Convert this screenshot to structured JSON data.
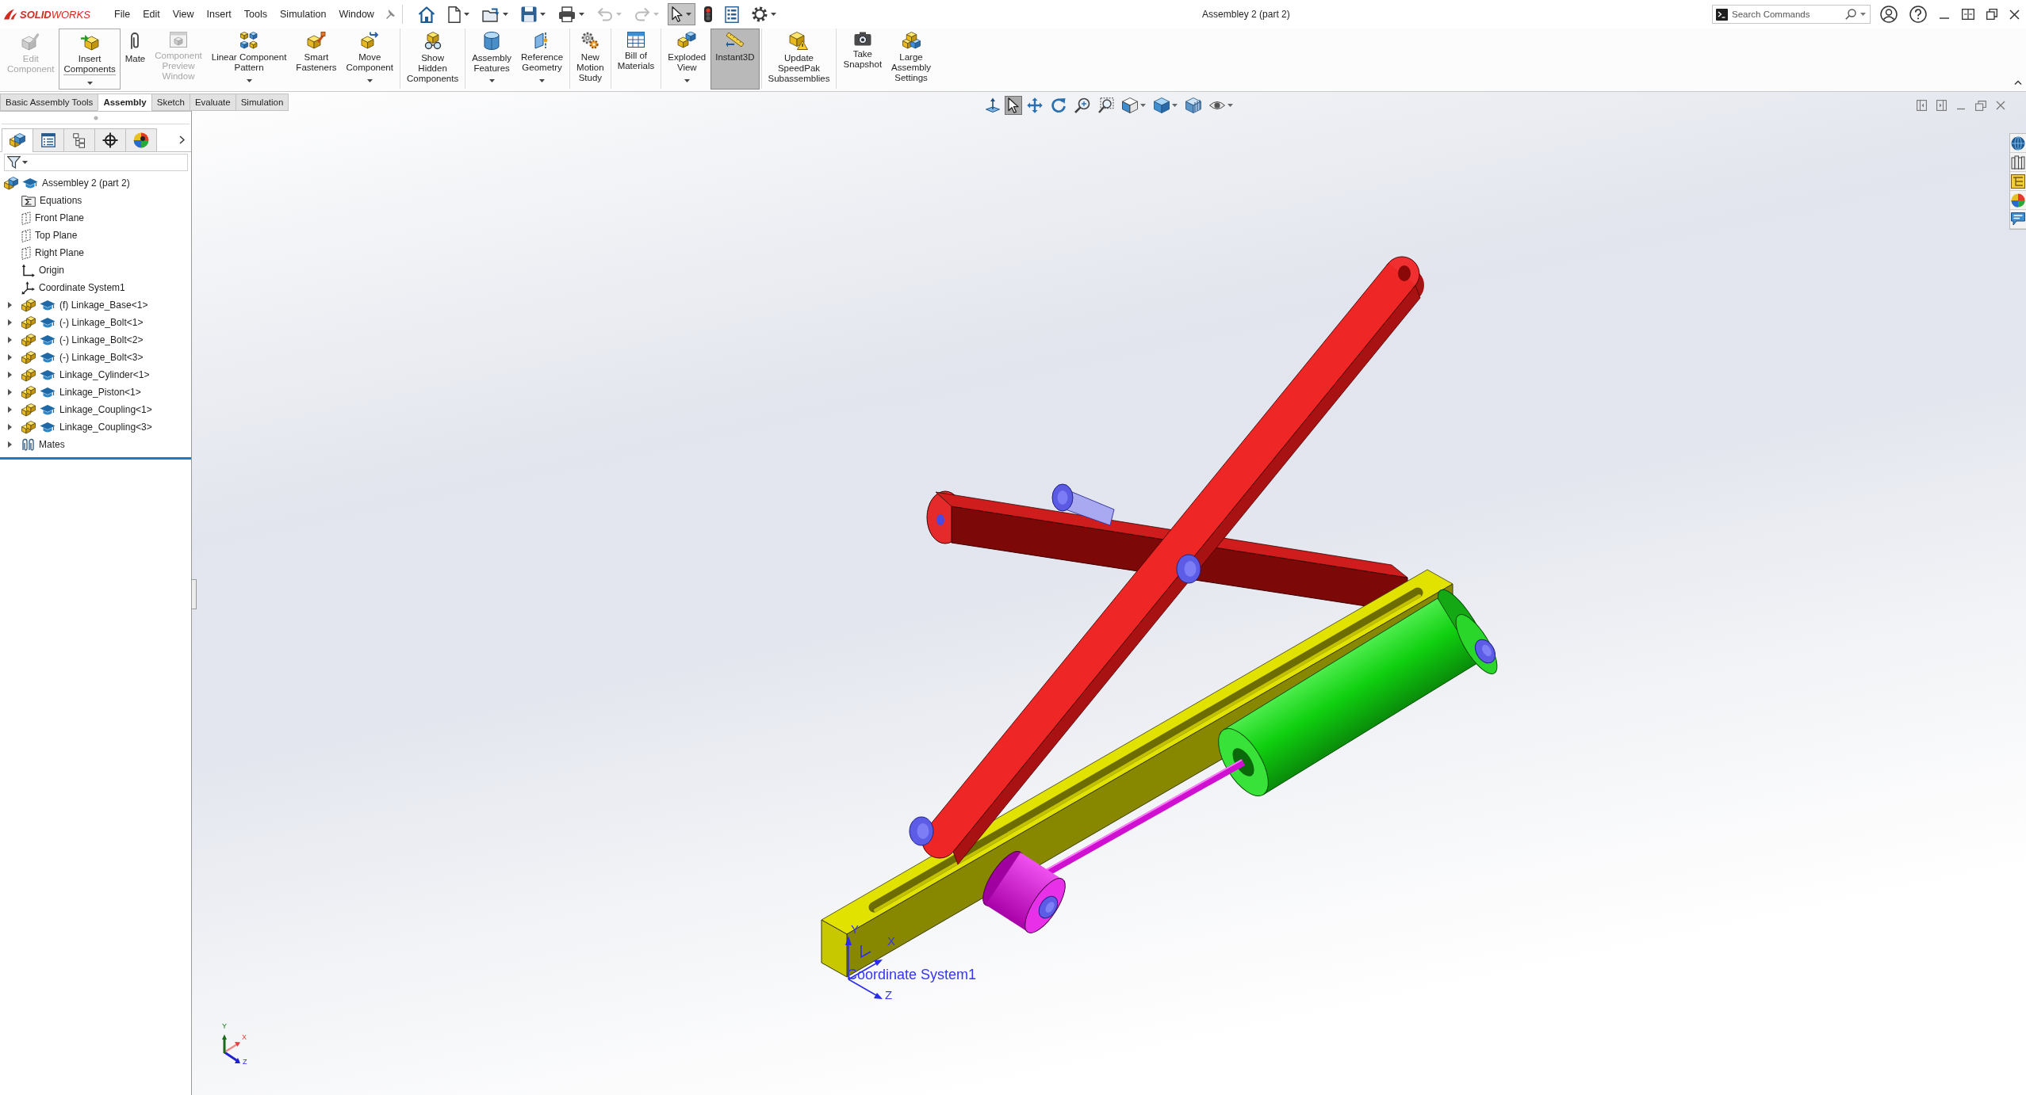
{
  "app": {
    "logo": "**SOLID**WORKS",
    "menu": [
      "File",
      "Edit",
      "View",
      "Insert",
      "Tools",
      "Simulation",
      "Window"
    ]
  },
  "quick_access": [
    {
      "kind": "home",
      "dropdown": false,
      "disabled": false,
      "selected": false
    },
    {
      "kind": "new",
      "dropdown": true,
      "disabled": false,
      "selected": false
    },
    {
      "kind": "open",
      "dropdown": true,
      "disabled": false,
      "selected": false
    },
    {
      "kind": "save",
      "dropdown": true,
      "disabled": false,
      "selected": false
    },
    {
      "kind": "print",
      "dropdown": true,
      "disabled": false,
      "selected": false
    },
    {
      "kind": "undo",
      "dropdown": true,
      "disabled": true,
      "selected": false
    },
    {
      "kind": "redo",
      "dropdown": true,
      "disabled": true,
      "selected": false
    },
    {
      "kind": "select",
      "dropdown": true,
      "disabled": false,
      "selected": true
    },
    {
      "kind": "rebuild",
      "dropdown": false,
      "disabled": false,
      "selected": false
    },
    {
      "kind": "file-properties",
      "dropdown": false,
      "disabled": false,
      "selected": false
    },
    {
      "kind": "options",
      "dropdown": true,
      "disabled": false,
      "selected": false
    }
  ],
  "window": {
    "title": "Assembley 2 (part 2)"
  },
  "search": {
    "placeholder": "Search Commands"
  },
  "ribbon": {
    "groups": [
      [
        {
          "kind": "edit-component",
          "label": "Edit\nComponent",
          "disabled": true,
          "selected": false,
          "dropdown": false,
          "split": false
        },
        {
          "kind": "insert-components",
          "label": "Insert\nComponents",
          "disabled": false,
          "selected": false,
          "dropdown": true,
          "split": true
        },
        {
          "kind": "mate",
          "label": "Mate",
          "disabled": false,
          "selected": false,
          "dropdown": false,
          "split": false
        },
        {
          "kind": "component-preview",
          "label": "Component\nPreview\nWindow",
          "disabled": true,
          "selected": false,
          "dropdown": false,
          "split": false
        },
        {
          "kind": "linear-pattern",
          "label": "Linear Component\nPattern",
          "disabled": false,
          "selected": false,
          "dropdown": true,
          "split": false
        },
        {
          "kind": "smart-fasteners",
          "label": "Smart\nFasteners",
          "disabled": false,
          "selected": false,
          "dropdown": false,
          "split": false
        },
        {
          "kind": "move-component",
          "label": "Move\nComponent",
          "disabled": false,
          "selected": false,
          "dropdown": true,
          "split": false
        }
      ],
      [
        {
          "kind": "show-hidden",
          "label": "Show\nHidden\nComponents",
          "disabled": false,
          "selected": false,
          "dropdown": false,
          "split": false
        }
      ],
      [
        {
          "kind": "assembly-features",
          "label": "Assembly\nFeatures",
          "disabled": false,
          "selected": false,
          "dropdown": true,
          "split": false
        },
        {
          "kind": "reference-geometry",
          "label": "Reference\nGeometry",
          "disabled": false,
          "selected": false,
          "dropdown": true,
          "split": false
        }
      ],
      [
        {
          "kind": "motion-study",
          "label": "New\nMotion\nStudy",
          "disabled": false,
          "selected": false,
          "dropdown": false,
          "split": false
        }
      ],
      [
        {
          "kind": "bom",
          "label": "Bill of\nMaterials",
          "disabled": false,
          "selected": false,
          "dropdown": false,
          "split": false
        }
      ],
      [
        {
          "kind": "exploded-view",
          "label": "Exploded\nView",
          "disabled": false,
          "selected": false,
          "dropdown": true,
          "split": false
        },
        {
          "kind": "instant3d",
          "label": "Instant3D",
          "disabled": false,
          "selected": true,
          "dropdown": false,
          "split": false
        }
      ],
      [
        {
          "kind": "speedpak",
          "label": "Update\nSpeedPak\nSubassemblies",
          "disabled": false,
          "selected": false,
          "dropdown": false,
          "split": false
        }
      ],
      [
        {
          "kind": "snapshot",
          "label": "Take\nSnapshot",
          "disabled": false,
          "selected": false,
          "dropdown": false,
          "split": false
        },
        {
          "kind": "large-assembly",
          "label": "Large\nAssembly\nSettings",
          "disabled": false,
          "selected": false,
          "dropdown": false,
          "split": false
        }
      ]
    ],
    "tabs": [
      {
        "label": "Basic Assembly Tools",
        "selected": false
      },
      {
        "label": "Assembly",
        "selected": true
      },
      {
        "label": "Sketch",
        "selected": false
      },
      {
        "label": "Evaluate",
        "selected": false
      },
      {
        "label": "Simulation",
        "selected": false
      }
    ]
  },
  "feature_manager": {
    "tabs": [
      {
        "kind": "feature-tree",
        "selected": true
      },
      {
        "kind": "property-manager",
        "selected": false
      },
      {
        "kind": "configuration-manager",
        "selected": false
      },
      {
        "kind": "dimxpert",
        "selected": false
      },
      {
        "kind": "display-manager",
        "selected": false
      }
    ],
    "tree": {
      "label": "Assembley 2 (part 2)",
      "kind": "assembly",
      "children": [
        {
          "label": "Equations",
          "kind": "equations"
        },
        {
          "label": "Front Plane",
          "kind": "plane"
        },
        {
          "label": "Top Plane",
          "kind": "plane"
        },
        {
          "label": "Right Plane",
          "kind": "plane"
        },
        {
          "label": "Origin",
          "kind": "origin"
        },
        {
          "label": "Coordinate System1",
          "kind": "coordinate-system"
        },
        {
          "label": "(f) Linkage_Base<1>",
          "kind": "part",
          "expanded": false
        },
        {
          "label": "(-) Linkage_Bolt<1>",
          "kind": "part",
          "expanded": false
        },
        {
          "label": "(-) Linkage_Bolt<2>",
          "kind": "part",
          "expanded": false
        },
        {
          "label": "(-) Linkage_Bolt<3>",
          "kind": "part",
          "expanded": false
        },
        {
          "label": "Linkage_Cylinder<1>",
          "kind": "part",
          "expanded": false
        },
        {
          "label": "Linkage_Piston<1>",
          "kind": "part",
          "expanded": false
        },
        {
          "label": "Linkage_Coupling<1>",
          "kind": "part",
          "expanded": false
        },
        {
          "label": "Linkage_Coupling<3>",
          "kind": "part",
          "expanded": false
        },
        {
          "label": "Mates",
          "kind": "mates",
          "expanded": false
        }
      ]
    }
  },
  "viewport": {
    "heads_up_toolbar": [
      {
        "kind": "normal-to",
        "selected": false,
        "dropdown": false
      },
      {
        "kind": "select",
        "selected": true,
        "dropdown": false
      },
      {
        "kind": "pan",
        "selected": false,
        "dropdown": false
      },
      {
        "kind": "rotate",
        "selected": false,
        "dropdown": false
      },
      {
        "kind": "zoom-fit",
        "selected": false,
        "dropdown": false
      },
      {
        "kind": "zoom-area",
        "selected": false,
        "dropdown": false
      },
      {
        "kind": "view-orientation",
        "selected": false,
        "dropdown": true
      },
      {
        "kind": "display-style",
        "selected": false,
        "dropdown": true
      },
      {
        "kind": "section-view",
        "selected": false,
        "dropdown": false
      },
      {
        "kind": "hide-show",
        "selected": false,
        "dropdown": true
      }
    ],
    "coordinate_system": {
      "label": "Coordinate System1",
      "axes": [
        "X",
        "Y",
        "Z"
      ]
    },
    "triad": {
      "axes": [
        "Y",
        "X",
        "Z"
      ]
    }
  }
}
